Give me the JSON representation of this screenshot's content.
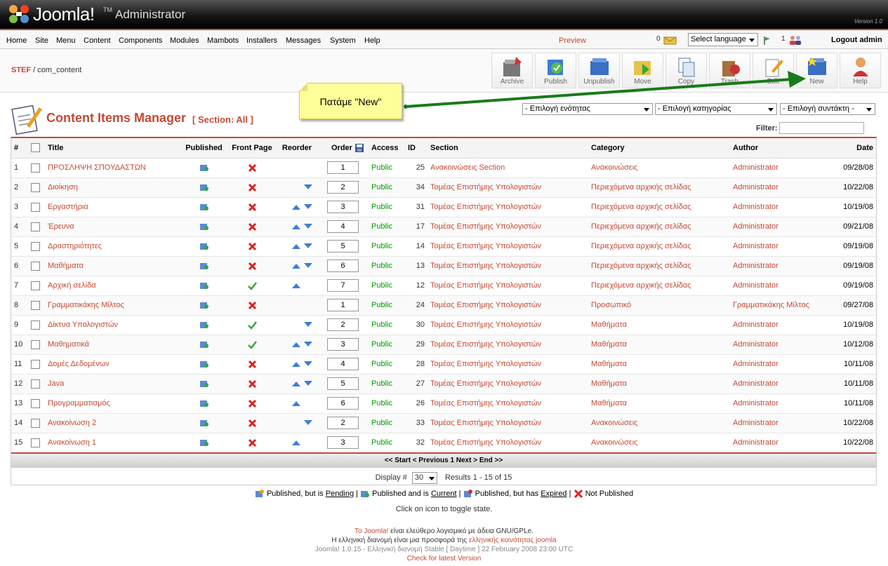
{
  "header": {
    "logo_text": "Joomla!",
    "logo_tm": "TM",
    "subtitle": "Administrator",
    "version": "Version 1.0"
  },
  "menu": {
    "items": [
      "Home",
      "Site",
      "Menu",
      "Content",
      "Components",
      "Modules",
      "Mambots",
      "Installers",
      "Messages",
      "System",
      "Help"
    ],
    "preview": "Preview",
    "message_count": "0",
    "language_select": "Select language",
    "user_count": "1",
    "logout": "Logout admin"
  },
  "breadcrumb": {
    "site": "STEF",
    "path": "/ com_content"
  },
  "toolbar": [
    "Archive",
    "Publish",
    "Unpublish",
    "Move",
    "Copy",
    "Trash",
    "Edit",
    "New",
    "Help"
  ],
  "page": {
    "title": "Content Items Manager",
    "section": "[ Section: All ]"
  },
  "filters": {
    "section": "- Επιλογή ενότητας",
    "category": "- Επιλογή κατηγορίας",
    "author": "- Επιλογή συντάκτη -",
    "filter_label": "Filter:"
  },
  "callout": {
    "text": "Πατάμε \"New\""
  },
  "table": {
    "headers": [
      "#",
      "",
      "Title",
      "Published",
      "Front Page",
      "Reorder",
      "Order",
      "Access",
      "ID",
      "Section",
      "Category",
      "Author",
      "Date"
    ],
    "rows": [
      {
        "n": "1",
        "title": "ΠΡΟΣΛΗΨΗ ΣΠΟΥΔΑΣΤΩΝ",
        "front": "x",
        "up": false,
        "down": false,
        "order": "1",
        "access": "Public",
        "id": "25",
        "section": "Ανακοινώσεις Section",
        "category": "Ανακοινώσεις",
        "author": "Administrator",
        "date": "09/28/08"
      },
      {
        "n": "2",
        "title": "Διοίκηση",
        "front": "x",
        "up": false,
        "down": true,
        "order": "2",
        "access": "Public",
        "id": "34",
        "section": "Τομέας Επιστήμης Υπολογιστών",
        "category": "Περιεχόμενα αρχικής σελίδας",
        "author": "Administrator",
        "date": "10/22/08"
      },
      {
        "n": "3",
        "title": "Εργαστήρια",
        "front": "x",
        "up": true,
        "down": true,
        "order": "3",
        "access": "Public",
        "id": "31",
        "section": "Τομέας Επιστήμης Υπολογιστών",
        "category": "Περιεχόμενα αρχικής σελίδας",
        "author": "Administrator",
        "date": "10/19/08"
      },
      {
        "n": "4",
        "title": "Έρευνα",
        "front": "x",
        "up": true,
        "down": true,
        "order": "4",
        "access": "Public",
        "id": "17",
        "section": "Τομέας Επιστήμης Υπολογιστών",
        "category": "Περιεχόμενα αρχικής σελίδας",
        "author": "Administrator",
        "date": "09/21/08"
      },
      {
        "n": "5",
        "title": "Δραστηριότητες",
        "front": "x",
        "up": true,
        "down": true,
        "order": "5",
        "access": "Public",
        "id": "14",
        "section": "Τομέας Επιστήμης Υπολογιστών",
        "category": "Περιεχόμενα αρχικής σελίδας",
        "author": "Administrator",
        "date": "09/19/08"
      },
      {
        "n": "6",
        "title": "Μαθήματα",
        "front": "x",
        "up": true,
        "down": true,
        "order": "6",
        "access": "Public",
        "id": "13",
        "section": "Τομέας Επιστήμης Υπολογιστών",
        "category": "Περιεχόμενα αρχικής σελίδας",
        "author": "Administrator",
        "date": "09/19/08"
      },
      {
        "n": "7",
        "title": "Αρχική σελίδα",
        "front": "check",
        "up": true,
        "down": false,
        "order": "7",
        "access": "Public",
        "id": "12",
        "section": "Τομέας Επιστήμης Υπολογιστών",
        "category": "Περιεχόμενα αρχικής σελίδας",
        "author": "Administrator",
        "date": "09/19/08"
      },
      {
        "n": "8",
        "title": "Γραμματικάκης Μίλτος",
        "front": "x",
        "up": false,
        "down": false,
        "order": "1",
        "access": "Public",
        "id": "24",
        "section": "Τομέας Επιστήμης Υπολογιστών",
        "category": "Προσωπικό",
        "author": "Γραμματικάκης Μίλτος",
        "date": "09/27/08"
      },
      {
        "n": "9",
        "title": "Δίκτυα Υπολογιστών",
        "front": "check",
        "up": false,
        "down": true,
        "order": "2",
        "access": "Public",
        "id": "30",
        "section": "Τομέας Επιστήμης Υπολογιστών",
        "category": "Μαθήματα",
        "author": "Administrator",
        "date": "10/19/08"
      },
      {
        "n": "10",
        "title": "Μαθηματικά",
        "front": "check",
        "up": true,
        "down": true,
        "order": "3",
        "access": "Public",
        "id": "29",
        "section": "Τομέας Επιστήμης Υπολογιστών",
        "category": "Μαθήματα",
        "author": "Administrator",
        "date": "10/12/08"
      },
      {
        "n": "11",
        "title": "Δομές Δεδομένων",
        "front": "x",
        "up": true,
        "down": true,
        "order": "4",
        "access": "Public",
        "id": "28",
        "section": "Τομέας Επιστήμης Υπολογιστών",
        "category": "Μαθήματα",
        "author": "Administrator",
        "date": "10/11/08"
      },
      {
        "n": "12",
        "title": "Java",
        "front": "x",
        "up": true,
        "down": true,
        "order": "5",
        "access": "Public",
        "id": "27",
        "section": "Τομέας Επιστήμης Υπολογιστών",
        "category": "Μαθήματα",
        "author": "Administrator",
        "date": "10/11/08"
      },
      {
        "n": "13",
        "title": "Προγραμματισμός",
        "front": "x",
        "up": true,
        "down": false,
        "order": "6",
        "access": "Public",
        "id": "26",
        "section": "Τομέας Επιστήμης Υπολογιστών",
        "category": "Μαθήματα",
        "author": "Administrator",
        "date": "10/11/08"
      },
      {
        "n": "14",
        "title": "Ανακοίνωση 2",
        "front": "x",
        "up": false,
        "down": true,
        "order": "2",
        "access": "Public",
        "id": "33",
        "section": "Τομέας Επιστήμης Υπολογιστών",
        "category": "Ανακοινώσεις",
        "author": "Administrator",
        "date": "10/22/08"
      },
      {
        "n": "15",
        "title": "Ανακοίνωση 1",
        "front": "x",
        "up": true,
        "down": false,
        "order": "3",
        "access": "Public",
        "id": "32",
        "section": "Τομέας Επιστήμης Υπολογιστών",
        "category": "Ανακοινώσεις",
        "author": "Administrator",
        "date": "10/22/08"
      }
    ]
  },
  "pager": {
    "text": "<< Start < Previous 1 Next > End >>",
    "display_label": "Display #",
    "display_value": "30",
    "results": "Results 1 - 15 of 15"
  },
  "legend": {
    "pending_a": "Published, but is ",
    "pending_b": "Pending",
    "current_a": "Published and is ",
    "current_b": "Current",
    "expired_a": "Published, but has ",
    "expired_b": "Expired",
    "not_published": "Not Published",
    "note": "Click on icon to toggle state."
  },
  "footer": {
    "line1_a": "To Joomla!",
    "line1_b": " είναι ελεύθερο λογισμικό με άδεια GNU/GPLe.",
    "line2_a": "Η ελληνική διανομή είναι μια προσφορά της ",
    "line2_b": "ελληνικής κοινότητας joomla",
    "line3": "Joomla! 1.0.15 - Ελληνική διανομή Stable [ Daytime ] 22 February 2008 23:00 UTC",
    "line4": "Check for latest Version"
  },
  "colors": {
    "accent": "#c64934",
    "public": "#009900",
    "arrow": "#1a7a1a",
    "callout": "#ffff99"
  }
}
